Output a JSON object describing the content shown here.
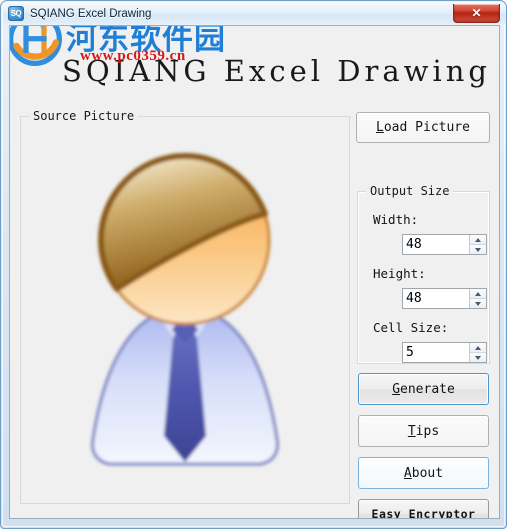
{
  "window": {
    "title": "SQIANG Excel Drawing",
    "icon_label": "SQ",
    "icon_name": "app-icon-sq",
    "close_glyph": "✕"
  },
  "watermark": {
    "site_name": "河东软件园",
    "url": "www.pc0359.cn",
    "logo_blue": "#1f7fd6",
    "logo_orange": "#f0952a",
    "url_color": "#d81818"
  },
  "heading": {
    "title": "SQIANG Excel Drawing"
  },
  "source_panel": {
    "group_label": "Source Picture",
    "image_alt": "user-avatar-placeholder"
  },
  "controls": {
    "load_picture": {
      "label": "Load Picture",
      "accel": "L",
      "rest": "oad Picture"
    },
    "output_size": {
      "group_label": "Output Size",
      "fields": [
        {
          "label": "Width:",
          "value": "48",
          "name": "width"
        },
        {
          "label": "Height:",
          "value": "48",
          "name": "height"
        },
        {
          "label": "Cell Size:",
          "value": "5",
          "name": "cell-size"
        }
      ]
    },
    "generate": {
      "accel": "G",
      "rest": "enerate",
      "label": "Generate"
    },
    "tips": {
      "accel": "T",
      "rest": "ips",
      "label": "Tips"
    },
    "about": {
      "accel": "A",
      "rest": "bout",
      "label": "About"
    },
    "easy_encryptor": {
      "label": "Easy Encryptor"
    }
  },
  "theme": {
    "client_bg": "#f0f0f0",
    "frame_accent": "#6f9fc4",
    "focus_border": "#4d97c9",
    "close_red": "#b52415"
  }
}
